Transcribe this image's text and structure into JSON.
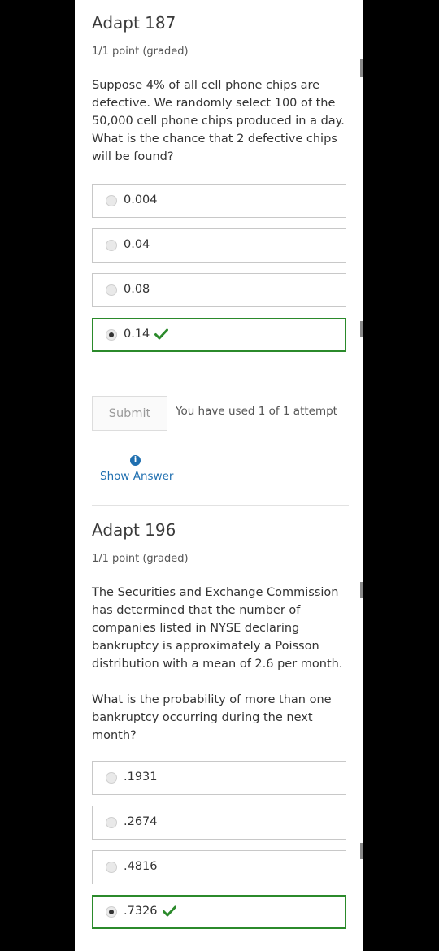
{
  "questions": [
    {
      "title": "Adapt 187",
      "points": "1/1 point (graded)",
      "text": "Suppose 4% of all cell phone chips are defective. We randomly select 100 of the 50,000 cell phone chips produced in a day. What is the chance that 2 defective chips will be found?",
      "choices": [
        "0.004",
        "0.04",
        "0.08",
        "0.14"
      ],
      "selected": "0.14"
    },
    {
      "title": "Adapt 196",
      "points": "1/1 point (graded)",
      "text": "The Securities and Exchange Commission has determined that the number of companies listed in NYSE declaring bankruptcy is approximately a Poisson distribution with a mean of 2.6 per month.",
      "text2": "What is the probability of more than one bankruptcy occurring during the next month?",
      "choices": [
        ".1931",
        ".2674",
        ".4816",
        ".7326"
      ],
      "selected": ".7326"
    }
  ],
  "submit": {
    "label": "Submit",
    "attempts": "You have used 1 of 1 attempt"
  },
  "show_answer": "Show Answer",
  "colors": {
    "correct": "#2b8a2b",
    "link": "#1f6fb0",
    "background": "#000000",
    "panel": "#ffffff"
  },
  "icons": {
    "correct": "checkmark-icon",
    "info": "info-icon"
  }
}
